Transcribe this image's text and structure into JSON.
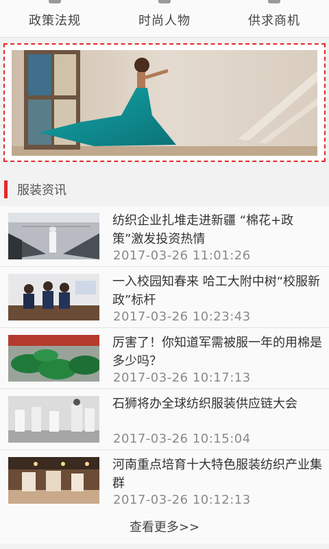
{
  "nav": {
    "items": [
      {
        "label": "政策法规"
      },
      {
        "label": "时尚人物"
      },
      {
        "label": "供求商机"
      }
    ]
  },
  "section": {
    "title": "服装资讯"
  },
  "news": [
    {
      "title": "纺织企业扎堆走进新疆 “棉花+政策”激发投资热情",
      "time": "2017-03-26 11:01:26"
    },
    {
      "title": "一入校园知春来 哈工大附中树“校服新政”标杆",
      "time": "2017-03-26 10:23:43"
    },
    {
      "title": "厉害了！你知道军需被服一年的用棉是多少吗？",
      "time": "2017-03-26 10:17:13"
    },
    {
      "title": "石狮将办全球纺织服装供应链大会",
      "time": "2017-03-26 10:15:04"
    },
    {
      "title": "河南重点培育十大特色服装纺织产业集群",
      "time": "2017-03-26 10:12:13"
    }
  ],
  "more": {
    "label": "查看更多>>"
  },
  "colors": {
    "accent": "#e02b2b",
    "text": "#333333",
    "time": "#8a8a8a",
    "bg": "#f2f2f2"
  }
}
